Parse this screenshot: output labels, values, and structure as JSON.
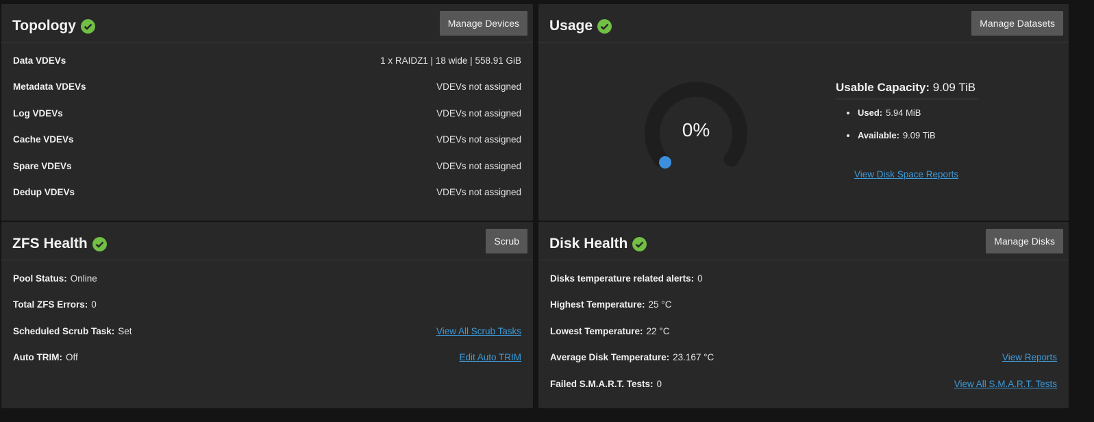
{
  "topology": {
    "title": "Topology",
    "button": "Manage Devices",
    "rows": [
      {
        "label": "Data VDEVs",
        "value": "1 x RAIDZ1 | 18 wide | 558.91 GiB"
      },
      {
        "label": "Metadata VDEVs",
        "value": "VDEVs not assigned"
      },
      {
        "label": "Log VDEVs",
        "value": "VDEVs not assigned"
      },
      {
        "label": "Cache VDEVs",
        "value": "VDEVs not assigned"
      },
      {
        "label": "Spare VDEVs",
        "value": "VDEVs not assigned"
      },
      {
        "label": "Dedup VDEVs",
        "value": "VDEVs not assigned"
      }
    ]
  },
  "usage": {
    "title": "Usage",
    "button": "Manage Datasets",
    "gauge_percent": "0%",
    "gauge_fraction": 0.0,
    "capacity_label": "Usable Capacity:",
    "capacity_value": "9.09 TiB",
    "used_label": "Used:",
    "used_value": "5.94 MiB",
    "available_label": "Available:",
    "available_value": "9.09 TiB",
    "link": "View Disk Space Reports"
  },
  "zfs_health": {
    "title": "ZFS Health",
    "button": "Scrub",
    "pool_status_label": "Pool Status:",
    "pool_status_value": "Online",
    "errors_label": "Total ZFS Errors:",
    "errors_value": "0",
    "scrub_task_label": "Scheduled Scrub Task:",
    "scrub_task_value": "Set",
    "scrub_link": "View All Scrub Tasks",
    "trim_label": "Auto TRIM:",
    "trim_value": "Off",
    "trim_link": "Edit Auto TRIM"
  },
  "disk_health": {
    "title": "Disk Health",
    "button": "Manage Disks",
    "temp_alerts_label": "Disks temperature related alerts:",
    "temp_alerts_value": "0",
    "highest_label": "Highest Temperature:",
    "highest_value": "25 °C",
    "lowest_label": "Lowest Temperature:",
    "lowest_value": "22 °C",
    "average_label": "Average Disk Temperature:",
    "average_value": "23.167 °C",
    "reports_link": "View Reports",
    "smart_label": "Failed S.M.A.R.T. Tests:",
    "smart_value": "0",
    "smart_link": "View All S.M.A.R.T. Tests"
  },
  "colors": {
    "healthy": "#71bf44",
    "link": "#3d9bda",
    "gauge_track": "#1e1e1e",
    "gauge_dot": "#3b8fdc"
  }
}
